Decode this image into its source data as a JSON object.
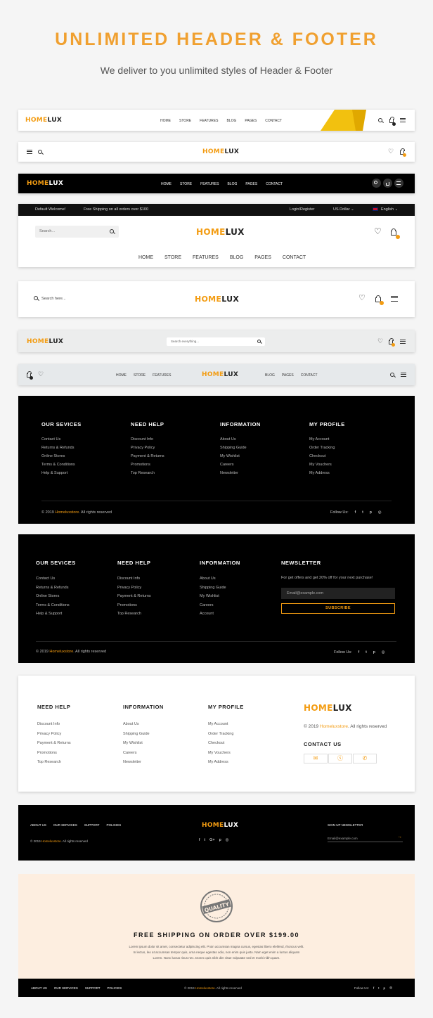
{
  "hero": {
    "title": "UNLIMITED HEADER & FOOTER",
    "subtitle": "We deliver to you unlimited styles of Header & Footer"
  },
  "brand": {
    "home": "HOME",
    "lux": "LUX",
    "store": "Homeluxstore"
  },
  "nav": [
    "HOME",
    "STORE",
    "FEATURES",
    "BLOG",
    "PAGES",
    "CONTACT"
  ],
  "header4": {
    "welcome": "Default Welcome!",
    "shipping": "Free Shipping on all orders over $100",
    "login": "Login/Register",
    "currency": "US Dollar",
    "language": "English",
    "search_placeholder": "Search..."
  },
  "header5": {
    "search_placeholder": "Search here..."
  },
  "header6": {
    "search_placeholder": "Search everything..."
  },
  "footer1": {
    "cols": [
      {
        "title": "OUR SEVICES",
        "items": [
          "Contact Us",
          "Returns & Refunds",
          "Online Stores",
          "Terms & Conditions",
          "Help & Support"
        ]
      },
      {
        "title": "NEED HELP",
        "items": [
          "Discount Info",
          "Privacy Policy",
          "Payment & Returns",
          "Promotions",
          "Top Research"
        ]
      },
      {
        "title": "INFORMATION",
        "items": [
          "About Us",
          "Shipping Guide",
          "My Wishlist",
          "Careers",
          "Newsletter"
        ]
      },
      {
        "title": "MY PROFILE",
        "items": [
          "My Account",
          "Order Tracking",
          "Checkout",
          "My Vouchers",
          "My Address"
        ]
      }
    ],
    "copyright_prefix": "© 2019 ",
    "copyright_suffix": ". All rights reserved",
    "follow": "Follow Us:"
  },
  "footer2": {
    "cols": [
      {
        "title": "OUR SEVICES",
        "items": [
          "Contact Us",
          "Returns & Refunds",
          "Online Stores",
          "Terms & Conditions",
          "Help & Support"
        ]
      },
      {
        "title": "NEED HELP",
        "items": [
          "Discount Info",
          "Privacy Policy",
          "Payment & Returns",
          "Promotions",
          "Top Research"
        ]
      },
      {
        "title": "INFORMATION",
        "items": [
          "About Us",
          "Shipping Guide",
          "My Wishlist",
          "Careers",
          "Account"
        ]
      }
    ],
    "newsletter_title": "NEWSLETTER",
    "newsletter_text": "For get offers and get 20% off for your next purchase!",
    "email_placeholder": "Email@example.com",
    "subscribe": "SUBSCRIBE"
  },
  "footer3": {
    "cols": [
      {
        "title": "NEED HELP",
        "items": [
          "Discount Info",
          "Privacy Policy",
          "Payment & Returns",
          "Promotions",
          "Top Research"
        ]
      },
      {
        "title": "INFORMATION",
        "items": [
          "About Us",
          "Shipping Guide",
          "My Wishlist",
          "Careers",
          "Newsletter"
        ]
      },
      {
        "title": "MY PROFILE",
        "items": [
          "My Account",
          "Order Tracking",
          "Checkout",
          "My Vouchers",
          "My Address"
        ]
      }
    ],
    "contact_title": "CONTACT US"
  },
  "footer4": {
    "links": [
      "ABOUT US",
      "OUR SERVICES",
      "SUPPORT",
      "POLICIES"
    ],
    "signup": "SIGN UP NEWSLETTER",
    "email_placeholder": "Email@example.com",
    "social": [
      "f",
      "t",
      "G+",
      "p",
      "ig"
    ]
  },
  "footer5": {
    "stamp": "QUALITY",
    "heading": "FREE SHIPPING ON ORDER OVER $199.00",
    "lorem1": "Lorem ipsum dolor sit amet, consectetur adipiscing elit. Proin accumsan magna cursus, egestas libero eleifend, rhoncus velit.",
    "lorem2": "In lectus, leo at accumsan tempor quis, urna neque egestas odio, non enim quis justo. Nam eget enim a luctus aliquam",
    "lorem3": "Lorem. Nunc luctus risus nec. Donec quis nibh dim vitae vulputate sed et morbi nibh quam.",
    "links": [
      "ABOUT US",
      "OUR SERVICES",
      "SUPPORT",
      "POLICIES"
    ],
    "follow": "Follow Us:"
  },
  "colors": {
    "accent": "#f39c12",
    "dark": "#000000",
    "cream": "#fdeee0"
  }
}
